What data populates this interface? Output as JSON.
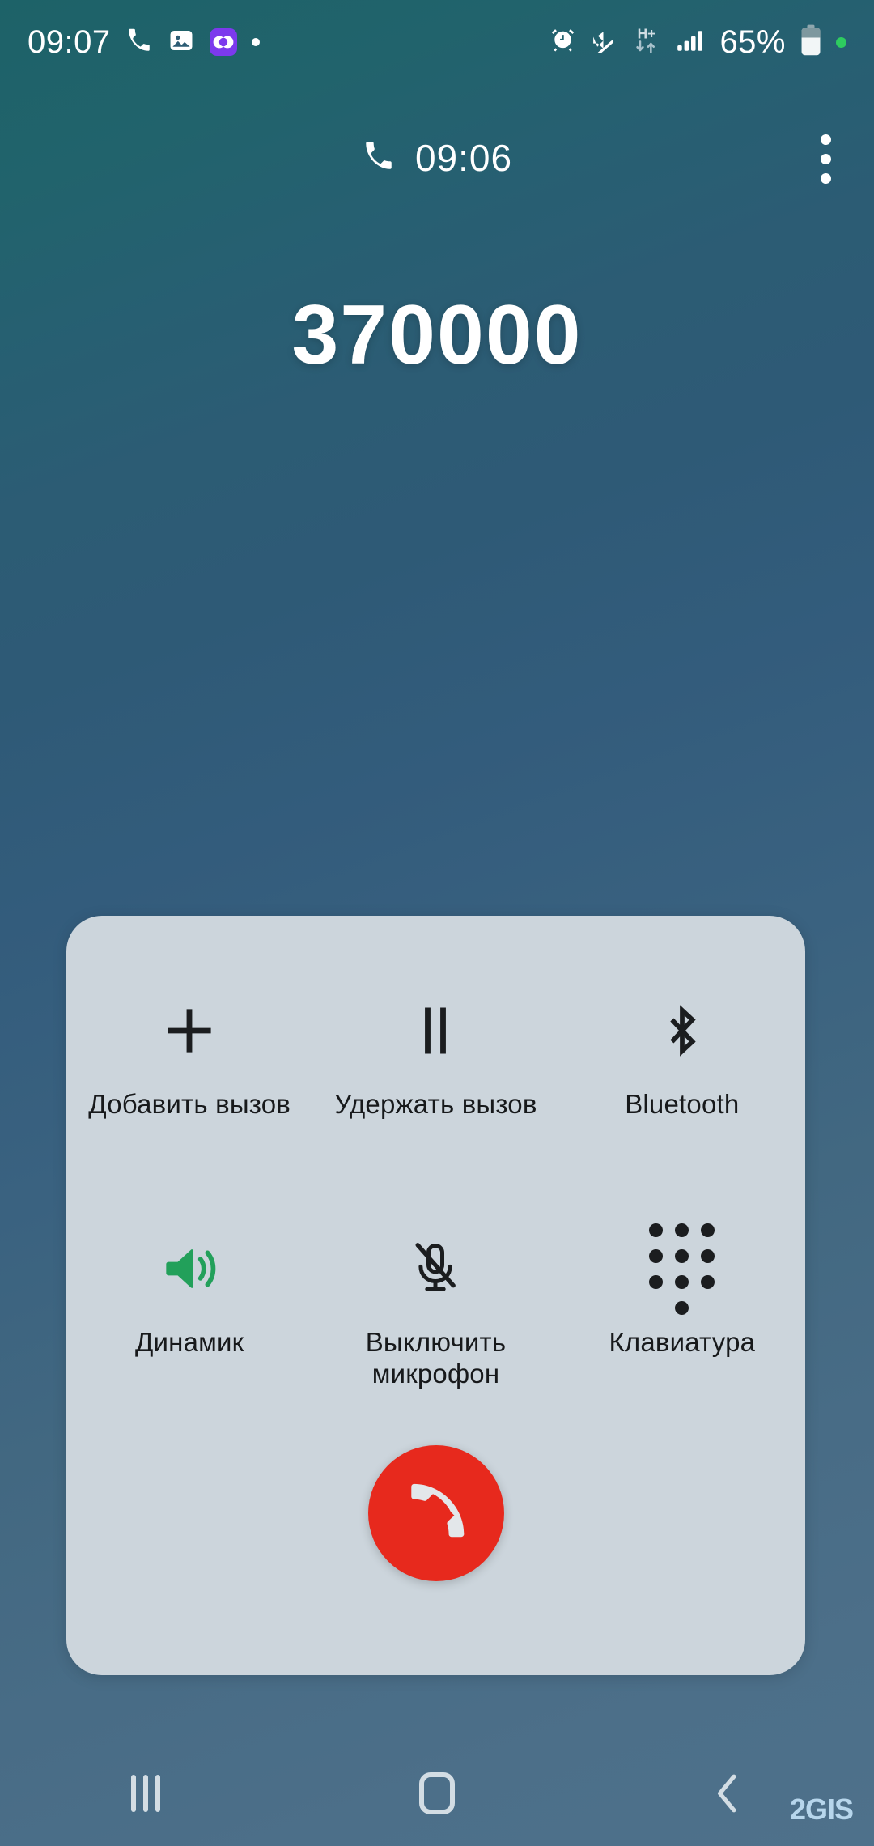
{
  "status_bar": {
    "clock": "09:07",
    "battery_percent": "65%",
    "network_type": "H+",
    "icons": [
      "phone-icon",
      "gallery-icon",
      "app-badge-icon",
      "notification-dot-icon",
      "alarm-icon",
      "mute-icon",
      "data-transfer-icon",
      "signal-bars-icon",
      "battery-icon",
      "recording-dot-icon"
    ]
  },
  "call_header": {
    "duration": "09:06",
    "phone_icon": "phone-icon",
    "overflow_icon": "overflow-menu-icon"
  },
  "call": {
    "number": "370000"
  },
  "controls": {
    "row1": [
      {
        "label": "Добавить вызов",
        "icon": "plus-icon",
        "active": false
      },
      {
        "label": "Удержать вызов",
        "icon": "pause-icon",
        "active": false
      },
      {
        "label": "Bluetooth",
        "icon": "bluetooth-icon",
        "active": false
      }
    ],
    "row2": [
      {
        "label": "Динамик",
        "icon": "speaker-icon",
        "active": true
      },
      {
        "label": "Выключить микрофон",
        "icon": "mic-off-icon",
        "active": false
      },
      {
        "label": "Клавиатура",
        "icon": "keypad-icon",
        "active": false
      }
    ],
    "end_call": {
      "icon": "end-call-icon",
      "color": "#e7291d"
    },
    "active_color": "#22a05a",
    "icon_color": "#1b1d1f",
    "panel_color": "#ccd5dc"
  },
  "nav_bar": {
    "recents": "recents-icon",
    "home": "home-icon",
    "back": "back-icon"
  },
  "watermark": {
    "text": "2GIS"
  }
}
